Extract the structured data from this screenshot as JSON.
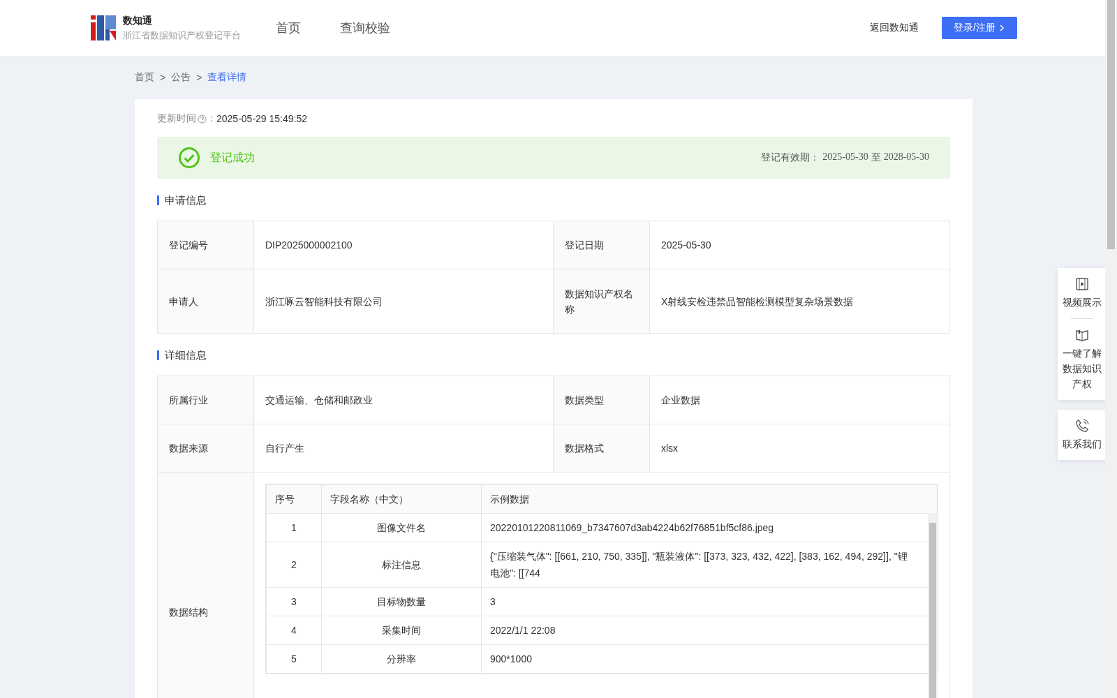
{
  "header": {
    "logo_title": "数知通",
    "logo_subtitle": "浙江省数据知识产权登记平台",
    "nav": [
      {
        "label": "首页",
        "selected": false
      },
      {
        "label": "查询校验",
        "selected": false
      }
    ],
    "back_link": "返回数知通",
    "login_button": "登录/注册"
  },
  "breadcrumb": [
    {
      "label": "首页",
      "selected": false
    },
    {
      "label": "公告",
      "selected": false
    },
    {
      "label": "查看详情",
      "selected": true
    }
  ],
  "breadcrumb_separator": ">",
  "update": {
    "label": "更新时间",
    "colon": "：",
    "value": "2025-05-29 15:49:52"
  },
  "status": {
    "text": "登记成功",
    "validity_label": "登记有效期：",
    "validity_from": "2025-05-30",
    "validity_to_word": "至",
    "validity_to": "2028-05-30"
  },
  "sections": [
    {
      "title": "申请信息",
      "rows": [
        {
          "label1": "登记编号",
          "value1": "DIP2025000002100",
          "label2": "登记日期",
          "value2": "2025-05-30"
        },
        {
          "label1": "申请人",
          "value1": "浙江啄云智能科技有限公司",
          "label2": "数据知识产权名称",
          "value2": "X射线安检违禁品智能检测模型复杂场景数据"
        }
      ]
    },
    {
      "title": "详细信息",
      "rows": [
        {
          "label1": "所属行业",
          "value1": "交通运输、仓储和邮政业",
          "label2": "数据类型",
          "value2": "企业数据"
        },
        {
          "label1": "数据来源",
          "value1": "自行产生",
          "label2": "数据格式",
          "value2": "xlsx"
        }
      ]
    }
  ],
  "structure": {
    "label": "数据结构",
    "columns": [
      "序号",
      "字段名称（中文）",
      "示例数据"
    ],
    "rows": [
      {
        "no": "1",
        "field": "图像文件名",
        "sample": "20220101220811069_b7347607d3ab4224b62f76851bf5cf86.jpeg"
      },
      {
        "no": "2",
        "field": "标注信息",
        "sample": "{\"压缩装气体\": [[661, 210, 750, 335]], \"瓶装液体\": [[373, 323, 432, 422], [383, 162, 494, 292]], \"锂电池\": [[744"
      },
      {
        "no": "3",
        "field": "目标物数量",
        "sample": "3"
      },
      {
        "no": "4",
        "field": "采集时间",
        "sample": "2022/1/1 22:08"
      },
      {
        "no": "5",
        "field": "分辨率",
        "sample": "900*1000"
      }
    ]
  },
  "side_panel": [
    {
      "kind": "video",
      "lines": [
        "视频展示"
      ]
    },
    {
      "kind": "book",
      "lines": [
        "一键了解",
        "数据知识",
        "产权"
      ]
    },
    {
      "kind": "phone",
      "lines": [
        "联系我们"
      ]
    }
  ]
}
